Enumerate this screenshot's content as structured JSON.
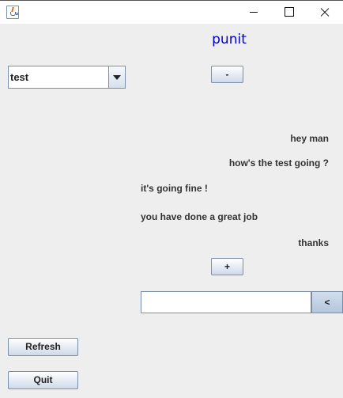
{
  "window": {
    "title": "",
    "controls": [
      "minimize",
      "maximize",
      "close"
    ]
  },
  "header": {
    "username": "punit"
  },
  "room_select": {
    "selected": "test"
  },
  "buttons": {
    "minus": "-",
    "plus": "+",
    "send": "<",
    "refresh": "Refresh",
    "quit": "Quit"
  },
  "messages": [
    {
      "text": "hey man",
      "align": "right"
    },
    {
      "text": "how's the test going ?",
      "align": "right"
    },
    {
      "text": "it's going fine !",
      "align": "left"
    },
    {
      "text": "you have done a great job",
      "align": "left"
    },
    {
      "text": "thanks",
      "align": "right"
    }
  ],
  "chat_input": {
    "value": "",
    "placeholder": ""
  },
  "colors": {
    "username": "#0000cc",
    "background": "#eeeeee",
    "button_border": "#7a8ea8"
  },
  "icons": {
    "app": "java-cup-icon"
  }
}
